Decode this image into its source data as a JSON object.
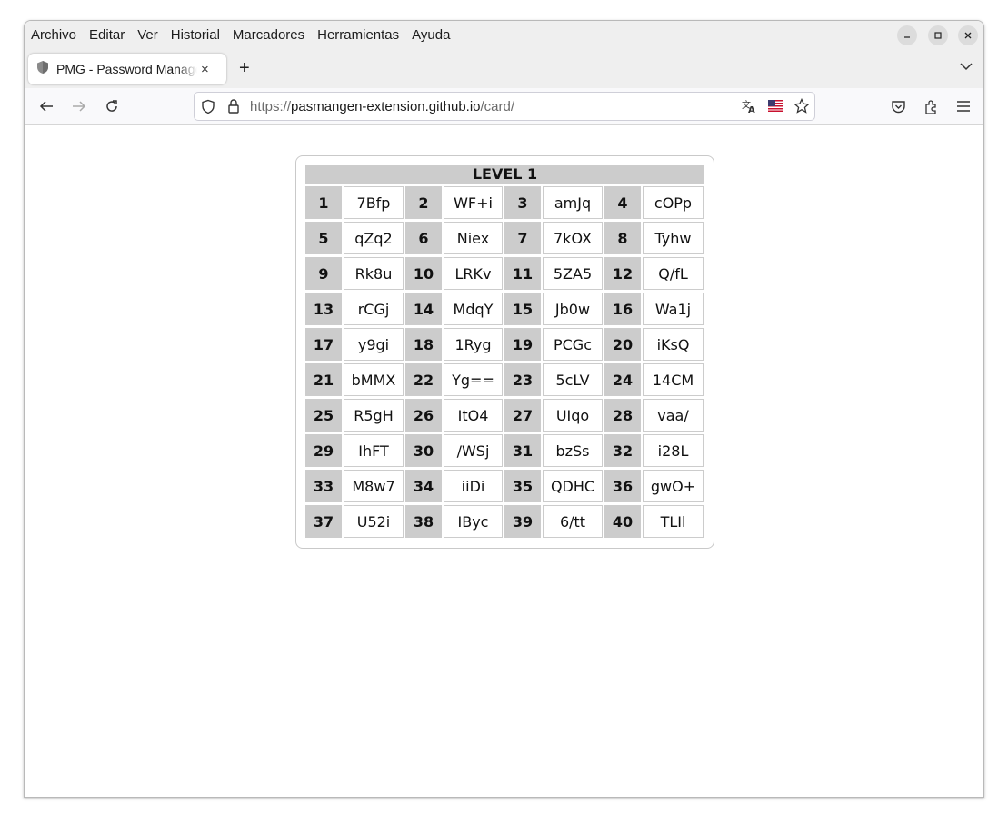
{
  "menu": [
    "Archivo",
    "Editar",
    "Ver",
    "Historial",
    "Marcadores",
    "Herramientas",
    "Ayuda"
  ],
  "window_controls": {
    "minimize_icon": "minimize-icon",
    "maximize_icon": "maximize-icon",
    "close_icon": "close-icon"
  },
  "tab": {
    "title": "PMG - Password Manager",
    "close": "×"
  },
  "newtab": "+",
  "url": {
    "scheme": "https://",
    "host": "pasmangen-extension.github.io",
    "path": "/card/"
  },
  "card": {
    "title": "LEVEL 1",
    "entries": [
      {
        "n": "1",
        "code": "7Bfp"
      },
      {
        "n": "2",
        "code": "WF+i"
      },
      {
        "n": "3",
        "code": "amJq"
      },
      {
        "n": "4",
        "code": "cOPp"
      },
      {
        "n": "5",
        "code": "qZq2"
      },
      {
        "n": "6",
        "code": "Niex"
      },
      {
        "n": "7",
        "code": "7kOX"
      },
      {
        "n": "8",
        "code": "Tyhw"
      },
      {
        "n": "9",
        "code": "Rk8u"
      },
      {
        "n": "10",
        "code": "LRKv"
      },
      {
        "n": "11",
        "code": "5ZA5"
      },
      {
        "n": "12",
        "code": "Q/fL"
      },
      {
        "n": "13",
        "code": "rCGj"
      },
      {
        "n": "14",
        "code": "MdqY"
      },
      {
        "n": "15",
        "code": "Jb0w"
      },
      {
        "n": "16",
        "code": "Wa1j"
      },
      {
        "n": "17",
        "code": "y9gi"
      },
      {
        "n": "18",
        "code": "1Ryg"
      },
      {
        "n": "19",
        "code": "PCGc"
      },
      {
        "n": "20",
        "code": "iKsQ"
      },
      {
        "n": "21",
        "code": "bMMX"
      },
      {
        "n": "22",
        "code": "Yg=="
      },
      {
        "n": "23",
        "code": "5cLV"
      },
      {
        "n": "24",
        "code": "14CM"
      },
      {
        "n": "25",
        "code": "R5gH"
      },
      {
        "n": "26",
        "code": "ItO4"
      },
      {
        "n": "27",
        "code": "UIqo"
      },
      {
        "n": "28",
        "code": "vaa/"
      },
      {
        "n": "29",
        "code": "IhFT"
      },
      {
        "n": "30",
        "code": "/WSj"
      },
      {
        "n": "31",
        "code": "bzSs"
      },
      {
        "n": "32",
        "code": "i28L"
      },
      {
        "n": "33",
        "code": "M8w7"
      },
      {
        "n": "34",
        "code": "iiDi"
      },
      {
        "n": "35",
        "code": "QDHC"
      },
      {
        "n": "36",
        "code": "gwO+"
      },
      {
        "n": "37",
        "code": "U52i"
      },
      {
        "n": "38",
        "code": "IByc"
      },
      {
        "n": "39",
        "code": "6/tt"
      },
      {
        "n": "40",
        "code": "TLIl"
      }
    ]
  }
}
